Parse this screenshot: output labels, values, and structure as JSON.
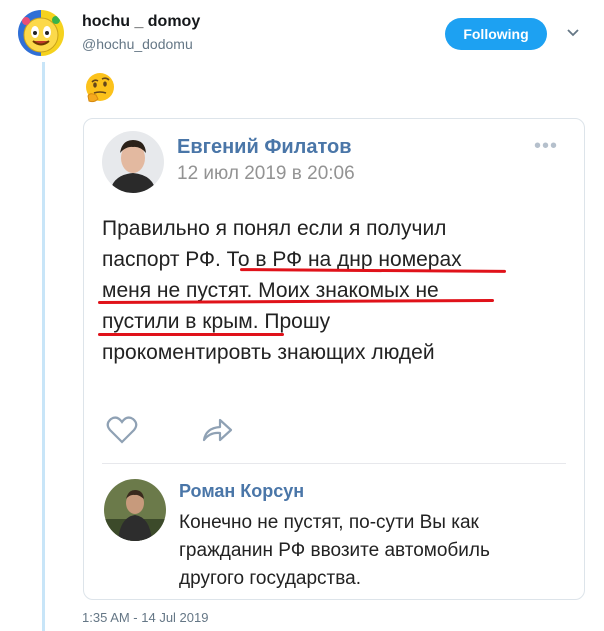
{
  "tweet": {
    "display_name": "hochu _ domoy",
    "handle": "@hochu_dodomu",
    "follow_label": "Following",
    "timestamp": "1:35 AM - 14 Jul 2019",
    "emoji_icon": "thinking-face-icon",
    "accent_color": "#1da1f2"
  },
  "vk_post": {
    "author": "Евгений Филатов",
    "date": "12 июл 2019 в 20:06",
    "text_lines": [
      "Правильно я понял если я получил",
      "паспорт РФ. То в РФ на днр номерах",
      "меня не пустят. Моих знакомых не",
      "пустили в крым. Прошу",
      "прокоментировть знающих людей"
    ],
    "link_color": "#4a76a8"
  },
  "vk_comment": {
    "author": "Роман Корсун",
    "text_lines": [
      "Конечно не пустят, по-сути Вы как",
      "гражданин РФ ввозите автомобиль",
      "другого государства."
    ]
  }
}
